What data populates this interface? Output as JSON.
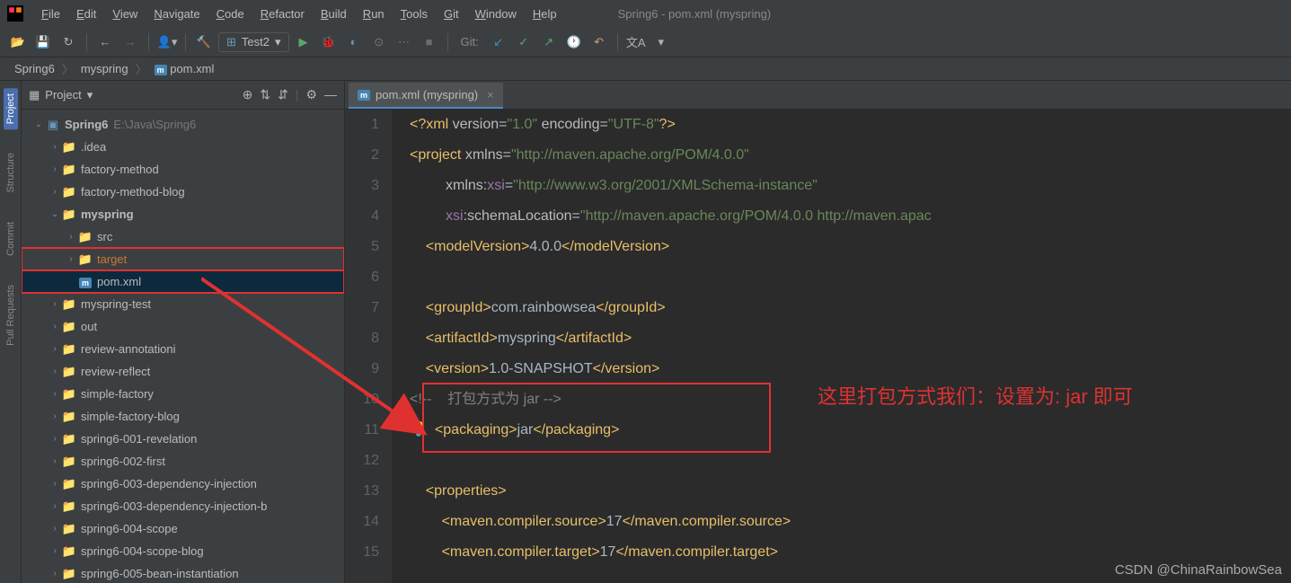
{
  "window_title": "Spring6 - pom.xml (myspring)",
  "menu": [
    "File",
    "Edit",
    "View",
    "Navigate",
    "Code",
    "Refactor",
    "Build",
    "Run",
    "Tools",
    "Git",
    "Window",
    "Help"
  ],
  "toolbar": {
    "run_config": "Test2",
    "git_label": "Git:"
  },
  "breadcrumb": [
    "Spring6",
    "myspring",
    "pom.xml"
  ],
  "left_tools": [
    "Project",
    "Structure",
    "Commit",
    "Pull Requests"
  ],
  "project_panel": {
    "title": "Project",
    "tree": [
      {
        "d": 0,
        "a": "v",
        "i": "proj",
        "t": "Spring6",
        "p": "E:\\Java\\Spring6",
        "bold": true
      },
      {
        "d": 1,
        "a": ">",
        "i": "fg",
        "t": ".idea"
      },
      {
        "d": 1,
        "a": ">",
        "i": "fg",
        "t": "factory-method"
      },
      {
        "d": 1,
        "a": ">",
        "i": "fg",
        "t": "factory-method-blog"
      },
      {
        "d": 1,
        "a": "v",
        "i": "fb",
        "t": "myspring",
        "bold": true
      },
      {
        "d": 2,
        "a": ">",
        "i": "fg",
        "t": "src"
      },
      {
        "d": 2,
        "a": ">",
        "i": "fo",
        "t": "target",
        "orange": true,
        "hl": true
      },
      {
        "d": 2,
        "a": "",
        "i": "m",
        "t": "pom.xml",
        "sel": true,
        "hl": true
      },
      {
        "d": 1,
        "a": ">",
        "i": "fg",
        "t": "myspring-test"
      },
      {
        "d": 1,
        "a": ">",
        "i": "fo",
        "t": "out"
      },
      {
        "d": 1,
        "a": ">",
        "i": "fg",
        "t": "review-annotationi"
      },
      {
        "d": 1,
        "a": ">",
        "i": "fg",
        "t": "review-reflect"
      },
      {
        "d": 1,
        "a": ">",
        "i": "fg",
        "t": "simple-factory"
      },
      {
        "d": 1,
        "a": ">",
        "i": "fg",
        "t": "simple-factory-blog"
      },
      {
        "d": 1,
        "a": ">",
        "i": "fg",
        "t": "spring6-001-revelation"
      },
      {
        "d": 1,
        "a": ">",
        "i": "fg",
        "t": "spring6-002-first"
      },
      {
        "d": 1,
        "a": ">",
        "i": "fg",
        "t": "spring6-003-dependency-injection"
      },
      {
        "d": 1,
        "a": ">",
        "i": "fg",
        "t": "spring6-003-dependency-injection-b"
      },
      {
        "d": 1,
        "a": ">",
        "i": "fg",
        "t": "spring6-004-scope"
      },
      {
        "d": 1,
        "a": ">",
        "i": "fg",
        "t": "spring6-004-scope-blog"
      },
      {
        "d": 1,
        "a": ">",
        "i": "fg",
        "t": "spring6-005-bean-instantiation"
      }
    ]
  },
  "editor": {
    "tab_label": "pom.xml (myspring)",
    "lines": [
      {
        "n": 1,
        "html": "<span class='xml-decl'>&lt;?</span><span class='tag'>xml </span><span class='attr-name'>version</span>=<span class='attr-val'>\"1.0\"</span> <span class='attr-name'>encoding</span>=<span class='attr-val'>\"UTF-8\"</span><span class='xml-decl'>?&gt;</span>"
      },
      {
        "n": 2,
        "html": "<span class='tag'>&lt;project </span><span class='attr-name'>xmlns</span>=<span class='attr-val'>\"http://maven.apache.org/POM/4.0.0\"</span>"
      },
      {
        "n": 3,
        "html": "         <span class='attr-name'>xmlns:</span><span class='ns'>xsi</span>=<span class='attr-val'>\"http://www.w3.org/2001/XMLSchema-instance\"</span>"
      },
      {
        "n": 4,
        "html": "         <span class='ns'>xsi</span><span class='attr-name'>:schemaLocation</span>=<span class='attr-val'>\"http://maven.apache.org/POM/4.0.0 http://maven.apac</span>"
      },
      {
        "n": 5,
        "html": "    <span class='tag'>&lt;modelVersion&gt;</span>4.0.0<span class='tag'>&lt;/modelVersion&gt;</span>"
      },
      {
        "n": 6,
        "html": ""
      },
      {
        "n": 7,
        "html": "    <span class='tag'>&lt;groupId&gt;</span>com.rainbowsea<span class='tag'>&lt;/groupId&gt;</span>"
      },
      {
        "n": 8,
        "html": "    <span class='tag'>&lt;artifactId&gt;</span>myspring<span class='tag'>&lt;/artifactId&gt;</span>"
      },
      {
        "n": 9,
        "html": "    <span class='tag'>&lt;version&gt;</span>1.0-SNAPSHOT<span class='tag'>&lt;/version&gt;</span>"
      },
      {
        "n": 10,
        "html": "<span class='comment'>&lt;!--    打包方式为 jar --&gt;</span>"
      },
      {
        "n": 11,
        "html": "<span class='bulb'>💡</span><span class='tag'>&lt;packaging&gt;</span>jar<span class='tag'>&lt;/packaging&gt;</span>"
      },
      {
        "n": 12,
        "html": ""
      },
      {
        "n": 13,
        "html": "    <span class='tag'>&lt;properties&gt;</span>"
      },
      {
        "n": 14,
        "html": "        <span class='tag'>&lt;maven.compiler.source&gt;</span>17<span class='tag'>&lt;/maven.compiler.source&gt;</span>"
      },
      {
        "n": 15,
        "html": "        <span class='tag'>&lt;maven.compiler.target&gt;</span>17<span class='tag'>&lt;/maven.compiler.target&gt;</span>"
      }
    ]
  },
  "annotation": {
    "text": "这里打包方式我们：设置为: jar 即可"
  },
  "watermark": "CSDN @ChinaRainbowSea"
}
